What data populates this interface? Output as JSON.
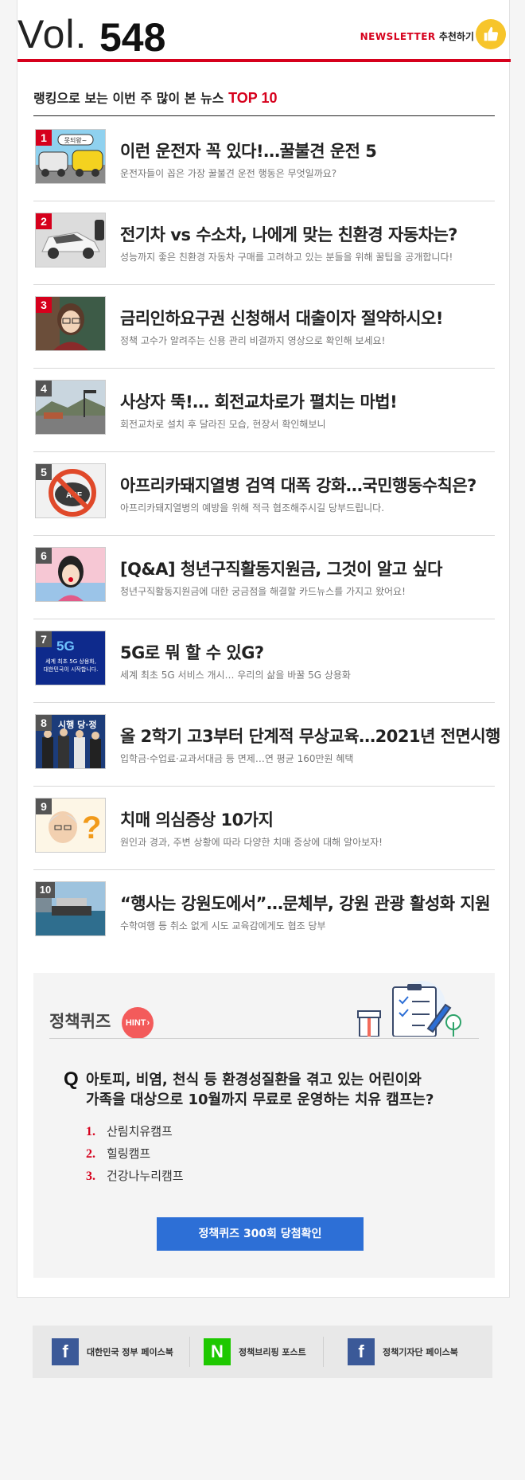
{
  "header": {
    "vol_prefix": "Vol.",
    "vol_number": "548",
    "newsletter_label": "NEWSLETTER",
    "recommend_label": "추천하기"
  },
  "ranking": {
    "title_prefix": "랭킹으로 보는 이번 주 많이 본 뉴스",
    "title_highlight": "TOP 10",
    "items": [
      {
        "rank": "1",
        "title": "이런 운전자 꼭 있다!…꿀불견 운전 5",
        "subtitle": "운전자들이 꼽은 가장 꿀불견 운전 행동은 무엇일까요?",
        "badge_color": "#d6001c"
      },
      {
        "rank": "2",
        "title": "전기차 vs 수소차, 나에게 맞는 친환경 자동차는?",
        "subtitle": "성능까지 좋은 친환경 자동차 구매를 고려하고 있는 분들을 위해 꿀팁을 공개합니다!",
        "badge_color": "#d6001c"
      },
      {
        "rank": "3",
        "title": "금리인하요구권 신청해서 대출이자 절약하시오!",
        "subtitle": "정책 고수가 알려주는 신용 관리 비결까지 영상으로 확인해 보세요!",
        "badge_color": "#d6001c"
      },
      {
        "rank": "4",
        "title": "사상자 뚝!… 회전교차로가 펼치는 마법!",
        "subtitle": "회전교차로 설치 후 달라진 모습, 현장서 확인해보니",
        "badge_color": "#555555"
      },
      {
        "rank": "5",
        "title": "아프리카돼지열병 검역 대폭 강화…국민행동수칙은?",
        "subtitle": "아프리카돼지열병의 예방을 위해 적극 협조해주시길 당부드립니다.",
        "badge_color": "#555555"
      },
      {
        "rank": "6",
        "title": "[Q&A] 청년구직활동지원금, 그것이 알고 싶다",
        "subtitle": "청년구직활동지원금에 대한 궁금점을 해결할 카드뉴스를 가지고 왔어요!",
        "badge_color": "#555555"
      },
      {
        "rank": "7",
        "title": "5G로 뭐 할 수 있G?",
        "subtitle": "세계 최초 5G 서비스 개시… 우리의 삶을 바꿀 5G 상용화",
        "badge_color": "#555555"
      },
      {
        "rank": "8",
        "title": "올 2학기 고3부터 단계적 무상교육…2021년 전면시행",
        "subtitle": "입학금·수업료·교과서대금 등 면제…연 평균 160만원 혜택",
        "badge_color": "#555555"
      },
      {
        "rank": "9",
        "title": "치매 의심증상 10가지",
        "subtitle": "원인과 경과, 주변 상황에 따라 다양한 치매 증상에 대해 알아보자!",
        "badge_color": "#555555"
      },
      {
        "rank": "10",
        "title": "“행사는 강원도에서”…문체부, 강원 관광 활성화 지원",
        "subtitle": "수학여행 등 취소 없게 시도 교육감에게도 협조 당부",
        "badge_color": "#555555"
      }
    ],
    "thumb_texts": {
      "t1": "못되왕~",
      "t5": "ASF",
      "t7_logo": "5G",
      "t7_line1": "세계 최초 5G 상용화,",
      "t7_line2": "대한민국이 시작합니다.",
      "t8": "시행 당·정"
    }
  },
  "quiz": {
    "title": "정책퀴즈",
    "hint_label": "HINT",
    "q_mark": "Q",
    "question_line1": "아토피, 비염, 천식 등 환경성질환을 겪고 있는 어린이와",
    "question_line2": "가족을 대상으로 10월까지 무료로 운영하는 치유 캠프는?",
    "options": [
      {
        "num": "1.",
        "label": "산림치유캠프"
      },
      {
        "num": "2.",
        "label": "힐링캠프"
      },
      {
        "num": "3.",
        "label": "건강나누리캠프"
      }
    ],
    "button_label": "정책퀴즈 300회 당첨확인"
  },
  "footer": {
    "links": [
      {
        "icon": "f",
        "label": "대한민국 정부 페이스북",
        "color": "#3b5998"
      },
      {
        "icon": "N",
        "label": "정책브리핑 포스트",
        "color": "#1ec800"
      },
      {
        "icon": "f",
        "label": "정책기자단 페이스북",
        "color": "#3b5998"
      }
    ]
  }
}
